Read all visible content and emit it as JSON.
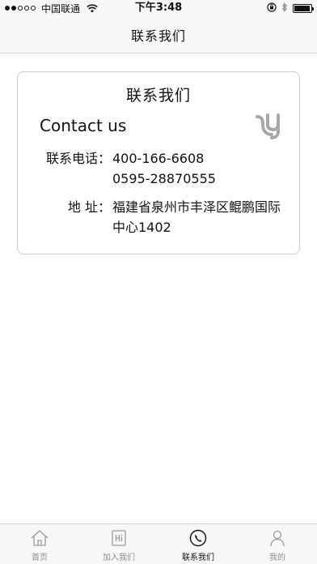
{
  "status_bar": {
    "carrier": "中国联通",
    "time": "下午3:48",
    "signal_filled": 2,
    "signal_total": 5,
    "battery_level": 0.95
  },
  "nav": {
    "title": "联系我们"
  },
  "card": {
    "title": "联系我们",
    "subtitle": "Contact us",
    "logo_icon": "company-logo-icon",
    "phone_label": "联系电话：",
    "phones": [
      "400-166-6608",
      "0595-28870555"
    ],
    "address_label": "地 址：",
    "address_lines": [
      "福建省泉州市丰泽区鲲鹏国际",
      "中心1402"
    ]
  },
  "tabs": [
    {
      "label": "首页",
      "icon": "home-icon",
      "active": false
    },
    {
      "label": "加入我们",
      "icon": "hi-sign-icon",
      "active": false
    },
    {
      "label": "联系我们",
      "icon": "phone-icon",
      "active": true
    },
    {
      "label": "我的",
      "icon": "person-icon",
      "active": false
    }
  ],
  "colors": {
    "bar_background": "#f7f7f7",
    "active_tab": "#111111",
    "inactive_tab": "#8e8e8e",
    "card_border": "#cfcfcf",
    "logo_gray": "#a8a8a8"
  }
}
